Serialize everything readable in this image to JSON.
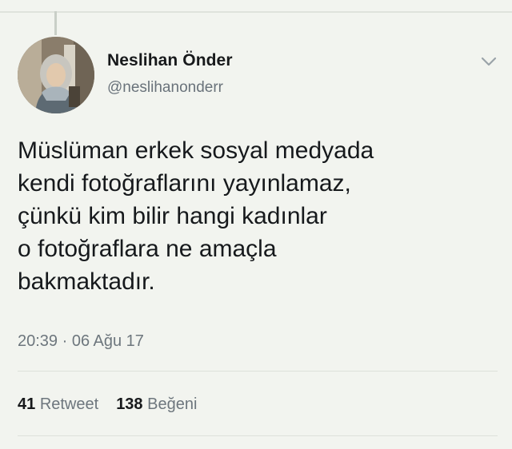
{
  "tweet": {
    "author": {
      "display_name": "Neslihan Önder",
      "handle": "@neslihanonderr",
      "avatar_icon": "profile-photo"
    },
    "text": "Müslüman erkek sosyal medyada\nkendi fotoğraflarını yayınlamaz,\nçünkü kim bilir hangi kadınlar\no fotoğraflara ne amaçla\nbakmaktadır.",
    "timestamp": "20:39 · 06 Ağu 17",
    "stats": {
      "retweet_count": "41",
      "retweet_label": "Retweet",
      "like_count": "138",
      "like_label": "Beğeni"
    },
    "menu_icon": "chevron-down-icon"
  },
  "colors": {
    "background": "#f2f4ef",
    "text": "#16191c",
    "secondary_text": "#6d767d"
  }
}
